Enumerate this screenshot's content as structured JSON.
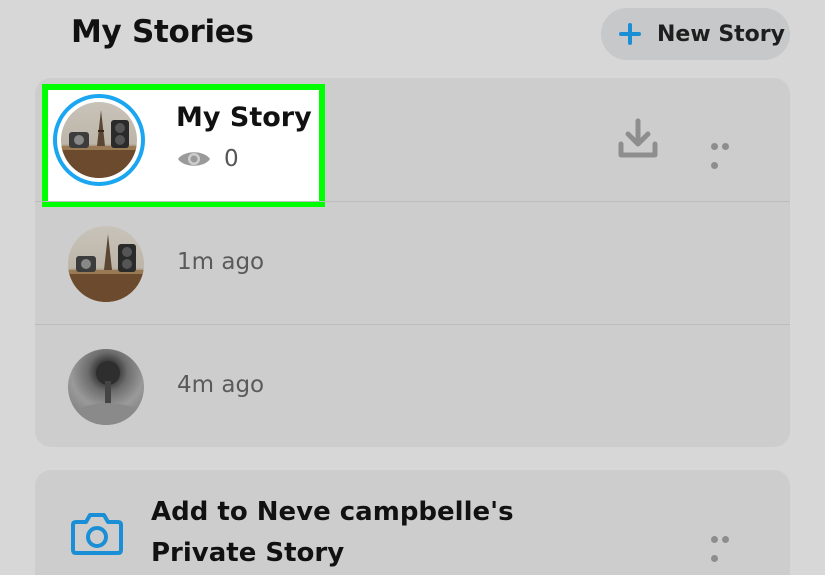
{
  "header": {
    "title": "My Stories",
    "new_story_label": "New Story"
  },
  "my_story": {
    "title": "My Story",
    "view_count": "0"
  },
  "story_items": [
    {
      "time": "1m ago"
    },
    {
      "time": "4m ago"
    }
  ],
  "private_story": {
    "line1": "Add to Neve campbelle's",
    "line2": "Private Story"
  },
  "colors": {
    "accent_blue": "#1aa6f0",
    "highlight_green": "#00ff00"
  },
  "icons": [
    "plus-icon",
    "eye-icon",
    "download-icon",
    "more-icon",
    "camera-icon"
  ]
}
